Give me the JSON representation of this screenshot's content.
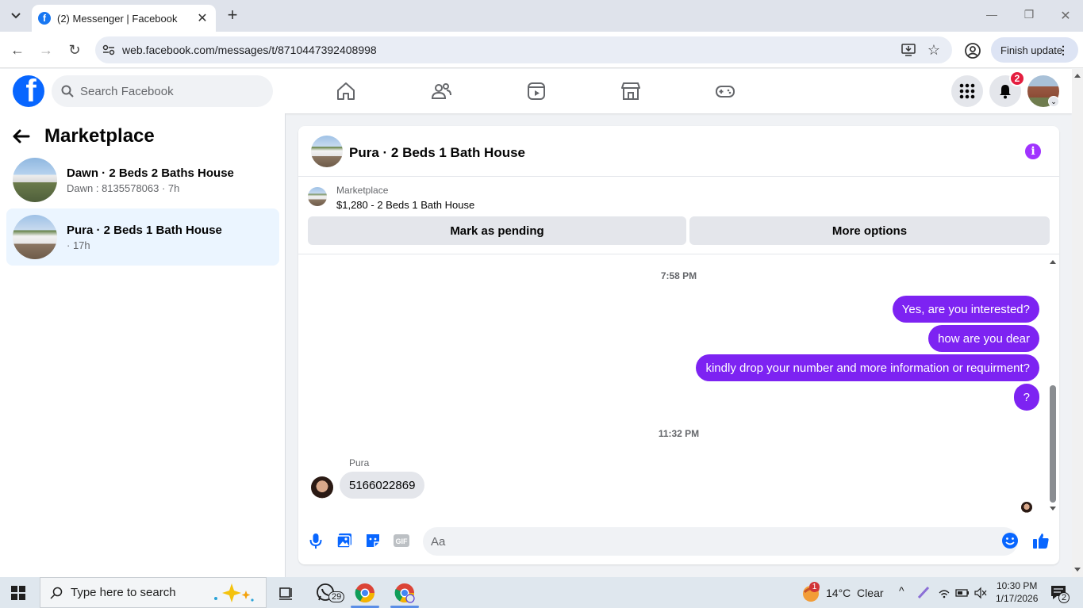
{
  "browser": {
    "tab_title": "(2) Messenger | Facebook",
    "url": "web.facebook.com/messages/t/8710447392408998",
    "finish_update": "Finish update"
  },
  "fb": {
    "search_placeholder": "Search Facebook",
    "notification_count": "2",
    "nav_icons": [
      "home-icon",
      "friends-icon",
      "watch-icon",
      "marketplace-icon",
      "gaming-icon"
    ]
  },
  "sidebar": {
    "title": "Marketplace",
    "conversations": [
      {
        "title": "Dawn · 2 Beds 2 Baths House",
        "subtitle": "Dawn : 8135578063 · 7h",
        "active": false
      },
      {
        "title": "Pura · 2 Beds 1 Bath House",
        "subtitle": "· 17h",
        "active": true
      }
    ]
  },
  "chat": {
    "header_title": "Pura · 2 Beds 1 Bath House",
    "listing_label": "Marketplace",
    "listing_price": "$1,280 - 2 Beds 1 Bath House",
    "mark_pending": "Mark as pending",
    "more_options": "More options",
    "messages": {
      "time1": "7:58 PM",
      "out1": "Yes, are you interested?",
      "out2": "how are you dear",
      "out3": "kindly  drop your number and more information or requirment?",
      "out4": "?",
      "time2": "11:32 PM",
      "sender": "Pura",
      "in1": "5166022869"
    },
    "composer_placeholder": "Aa",
    "accent_color": "#7d23f2"
  },
  "taskbar": {
    "search_placeholder": "Type here to search",
    "whatsapp_badge": "29",
    "weather": "14°C  Clear",
    "weather_badge": "1",
    "time": "10:30 PM",
    "date": "1/17/2026",
    "notification_count": "2"
  }
}
